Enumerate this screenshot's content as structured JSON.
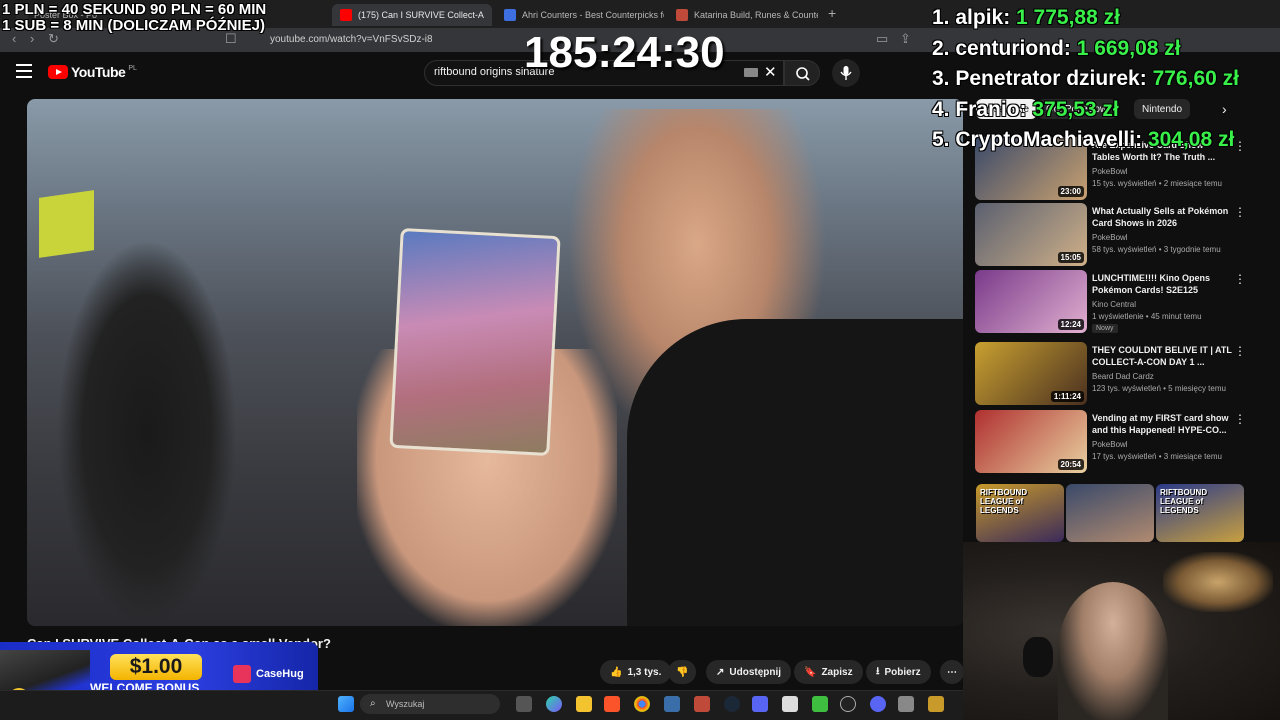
{
  "overlay": {
    "donation_rules": [
      "1 PLN = 40 SEKUND 90 PLN = 60 MIN",
      "1 SUB = 8 MIN (DOLICZAM PÓŹNIEJ)"
    ],
    "timer": "185:24:30",
    "leaderboard": [
      {
        "rank_name": "1. alpik:",
        "amount": "1 775,88 zł"
      },
      {
        "rank_name": "2. centuriond:",
        "amount": "1 669,08 zł"
      },
      {
        "rank_name": "3. Penetrator dziurek:",
        "amount": "776,60 zł"
      },
      {
        "rank_name": "4. Franio:",
        "amount": "375,53 zł"
      },
      {
        "rank_name": "5. CryptoMachiavelli:",
        "amount": "304,08 zł"
      }
    ]
  },
  "browser": {
    "tabs": [
      {
        "label": "Poster Box - Po",
        "color": "#e8e8e8"
      },
      {
        "label": "(175) Can I SURVIVE Collect-A",
        "color": "#ff0000"
      },
      {
        "label": "Ahri Counters - Best Counterpicks fo",
        "color": "#3d6fe0"
      },
      {
        "label": "Katarina Build, Runes & Counters Gu",
        "color": "#c04a3a"
      }
    ],
    "url": "youtube.com/watch?v=VnFSvSDz-i8"
  },
  "youtube": {
    "logo_text": "YouTube",
    "logo_region": "PL",
    "search_query": "riftbound origins sinature",
    "video_title": "Can I SURVIVE Collect-A-Con as a small Vendor?",
    "actions": {
      "likes": "1,3 tys.",
      "share": "Udostępnij",
      "save": "Zapisz",
      "download": "Pobierz"
    },
    "chips": [
      "Wszystkie",
      "Od: PokeBowl",
      "Nintendo"
    ],
    "recommendations": [
      {
        "title": "Are Expensive Card Show Tables Worth It? The Truth ...",
        "channel": "PokeBowl",
        "meta": "15 tys. wyświetleń • 2 miesiące temu",
        "duration": "23:00",
        "badge": "",
        "c1": "#3a4a6a",
        "c2": "#c8a070"
      },
      {
        "title": "What Actually Sells at Pokémon Card Shows in 2026",
        "channel": "PokeBowl",
        "meta": "58 tys. wyświetleń • 3 tygodnie temu",
        "duration": "15:05",
        "badge": "",
        "c1": "#5a6070",
        "c2": "#d0b088"
      },
      {
        "title": "LUNCHTIME!!!! Kino Opens Pokémon Cards! S2E125",
        "channel": "Kino Central",
        "meta": "1 wyświetlenie • 45 minut temu",
        "duration": "12:24",
        "badge": "Nowy",
        "c1": "#7a3a8a",
        "c2": "#e0b0d0"
      },
      {
        "title": "THEY COULDNT BELIVE IT | ATL COLLECT-A-CON DAY 1 ...",
        "channel": "Beard Dad Cardz",
        "meta": "123 tys. wyświetleń • 5 miesięcy temu",
        "duration": "1:11:24",
        "badge": "",
        "c1": "#c8a030",
        "c2": "#4a3020"
      },
      {
        "title": "Vending at my FIRST card show and this Happened! HYPE-CO...",
        "channel": "PokeBowl",
        "meta": "17 tys. wyświetleń • 3 miesiące temu",
        "duration": "20:54",
        "badge": "",
        "c1": "#b03030",
        "c2": "#e8d0a0"
      }
    ],
    "shorts": [
      {
        "label": "RIFTBOUND LEAGUE of LEGENDS",
        "c1": "#c89a2a",
        "c2": "#3a2a5a"
      },
      {
        "label": "",
        "c1": "#3a4a6a",
        "c2": "#b08a70"
      },
      {
        "label": "RIFTBOUND LEAGUE of LEGENDS",
        "c1": "#2a3a8a",
        "c2": "#c8a040"
      }
    ]
  },
  "ad": {
    "amount": "$1.00",
    "subtitle": "WELCOME BONUS",
    "brand": "CaseHug"
  },
  "taskbar": {
    "search_placeholder": "Wyszukaj"
  }
}
